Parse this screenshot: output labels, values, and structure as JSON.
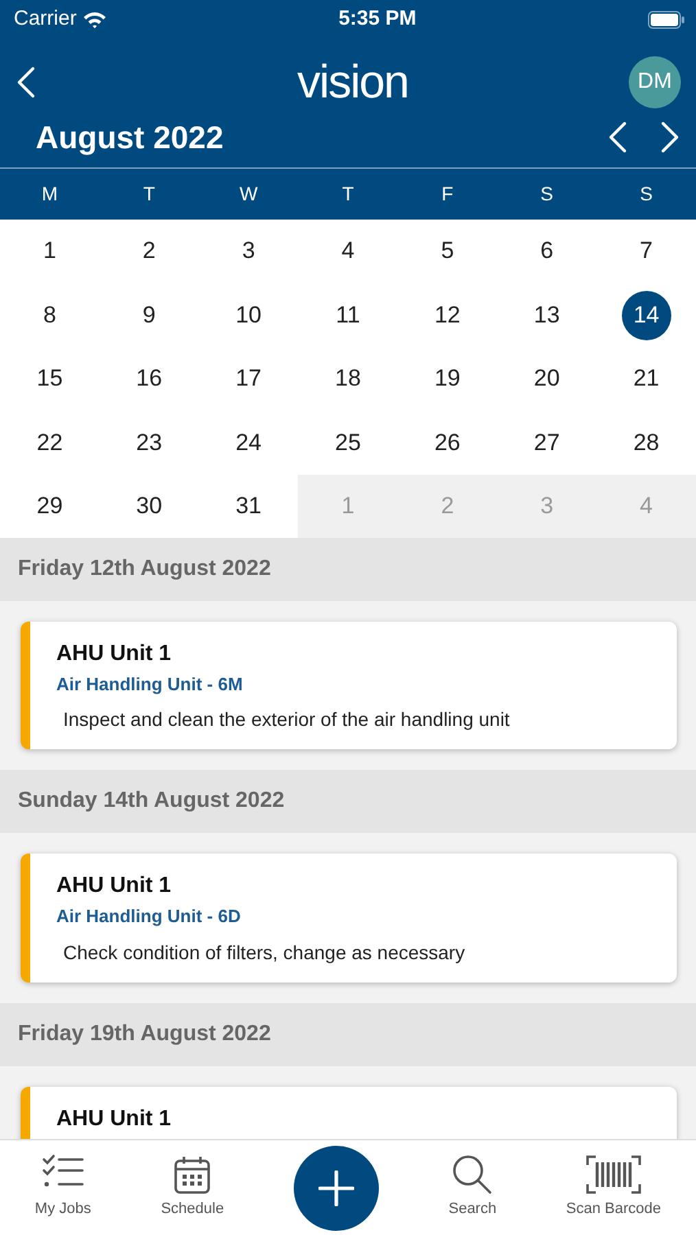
{
  "status_bar": {
    "carrier": "Carrier",
    "time": "5:35 PM"
  },
  "header": {
    "logo": "vision",
    "avatar": "DM"
  },
  "calendar": {
    "month": "August 2022",
    "weekdays": [
      "M",
      "T",
      "W",
      "T",
      "F",
      "S",
      "S"
    ],
    "days": [
      {
        "label": "1",
        "selected": false,
        "other_month": false
      },
      {
        "label": "2",
        "selected": false,
        "other_month": false
      },
      {
        "label": "3",
        "selected": false,
        "other_month": false
      },
      {
        "label": "4",
        "selected": false,
        "other_month": false
      },
      {
        "label": "5",
        "selected": false,
        "other_month": false
      },
      {
        "label": "6",
        "selected": false,
        "other_month": false
      },
      {
        "label": "7",
        "selected": false,
        "other_month": false
      },
      {
        "label": "8",
        "selected": false,
        "other_month": false
      },
      {
        "label": "9",
        "selected": false,
        "other_month": false
      },
      {
        "label": "10",
        "selected": false,
        "other_month": false
      },
      {
        "label": "11",
        "selected": false,
        "other_month": false
      },
      {
        "label": "12",
        "selected": false,
        "other_month": false
      },
      {
        "label": "13",
        "selected": false,
        "other_month": false
      },
      {
        "label": "14",
        "selected": true,
        "other_month": false
      },
      {
        "label": "15",
        "selected": false,
        "other_month": false
      },
      {
        "label": "16",
        "selected": false,
        "other_month": false
      },
      {
        "label": "17",
        "selected": false,
        "other_month": false
      },
      {
        "label": "18",
        "selected": false,
        "other_month": false
      },
      {
        "label": "19",
        "selected": false,
        "other_month": false
      },
      {
        "label": "20",
        "selected": false,
        "other_month": false
      },
      {
        "label": "21",
        "selected": false,
        "other_month": false
      },
      {
        "label": "22",
        "selected": false,
        "other_month": false
      },
      {
        "label": "23",
        "selected": false,
        "other_month": false
      },
      {
        "label": "24",
        "selected": false,
        "other_month": false
      },
      {
        "label": "25",
        "selected": false,
        "other_month": false
      },
      {
        "label": "26",
        "selected": false,
        "other_month": false
      },
      {
        "label": "27",
        "selected": false,
        "other_month": false
      },
      {
        "label": "28",
        "selected": false,
        "other_month": false
      },
      {
        "label": "29",
        "selected": false,
        "other_month": false
      },
      {
        "label": "30",
        "selected": false,
        "other_month": false
      },
      {
        "label": "31",
        "selected": false,
        "other_month": false
      },
      {
        "label": "1",
        "selected": false,
        "other_month": true
      },
      {
        "label": "2",
        "selected": false,
        "other_month": true
      },
      {
        "label": "3",
        "selected": false,
        "other_month": true
      },
      {
        "label": "4",
        "selected": false,
        "other_month": true
      }
    ]
  },
  "schedule": [
    {
      "date": "Friday 12th August 2022",
      "jobs": [
        {
          "title": "AHU Unit 1",
          "subtitle": "Air Handling Unit - 6M",
          "description": "Inspect and clean the exterior of the air handling unit",
          "color": "#f5a800"
        }
      ]
    },
    {
      "date": "Sunday 14th August 2022",
      "jobs": [
        {
          "title": "AHU Unit 1",
          "subtitle": "Air Handling Unit - 6D",
          "description": "Check condition of filters, change as necessary",
          "color": "#f5a800"
        }
      ]
    },
    {
      "date": "Friday 19th August 2022",
      "jobs": [
        {
          "title": "AHU Unit 1",
          "color": "#f5a800"
        }
      ]
    }
  ],
  "tab_bar": [
    {
      "kind": "jobs",
      "label": "My Jobs"
    },
    {
      "kind": "schedule",
      "label": "Schedule"
    },
    {
      "kind": "add"
    },
    {
      "kind": "search",
      "label": "Search"
    },
    {
      "kind": "barcode",
      "label": "Scan Barcode"
    }
  ]
}
